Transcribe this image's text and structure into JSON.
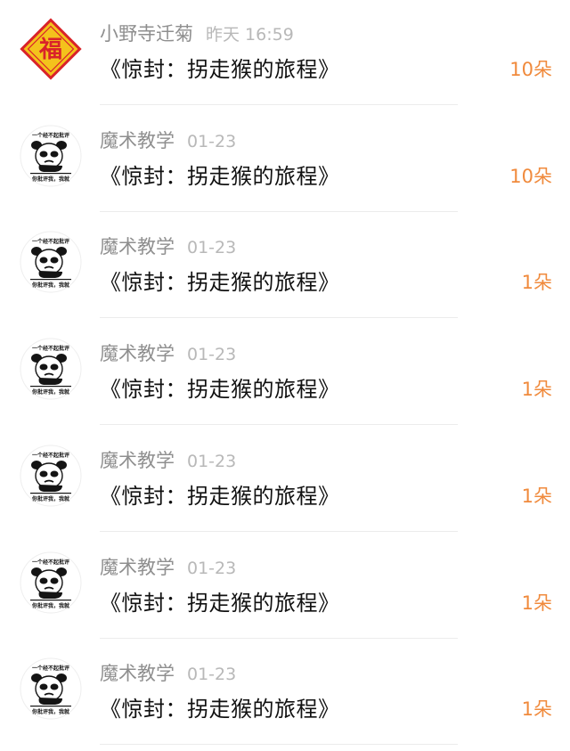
{
  "rows": [
    {
      "name": "小野寺迁菊",
      "time": "昨天 16:59",
      "title": "《惊封：拐走猴的旅程》",
      "count": "10朵",
      "avatar": "fu-icon"
    },
    {
      "name": "魔术教学",
      "time": "01-23",
      "title": "《惊封：拐走猴的旅程》",
      "count": "10朵",
      "avatar": "panda-meme-icon"
    },
    {
      "name": "魔术教学",
      "time": "01-23",
      "title": "《惊封：拐走猴的旅程》",
      "count": "1朵",
      "avatar": "panda-meme-icon"
    },
    {
      "name": "魔术教学",
      "time": "01-23",
      "title": "《惊封：拐走猴的旅程》",
      "count": "1朵",
      "avatar": "panda-meme-icon"
    },
    {
      "name": "魔术教学",
      "time": "01-23",
      "title": "《惊封：拐走猴的旅程》",
      "count": "1朵",
      "avatar": "panda-meme-icon"
    },
    {
      "name": "魔术教学",
      "time": "01-23",
      "title": "《惊封：拐走猴的旅程》",
      "count": "1朵",
      "avatar": "panda-meme-icon"
    },
    {
      "name": "魔术教学",
      "time": "01-23",
      "title": "《惊封：拐走猴的旅程》",
      "count": "1朵",
      "avatar": "panda-meme-icon"
    }
  ],
  "avatar_text": {
    "fu": "福",
    "panda_top": "一个经不起批评",
    "panda_bottom": "你批评我，我就"
  },
  "colors": {
    "count": "#f08a3c",
    "name": "#8f8f8f",
    "time": "#b8b8b8",
    "title": "#111111",
    "fu_red": "#d9232a",
    "fu_gold": "#f4c21c"
  }
}
